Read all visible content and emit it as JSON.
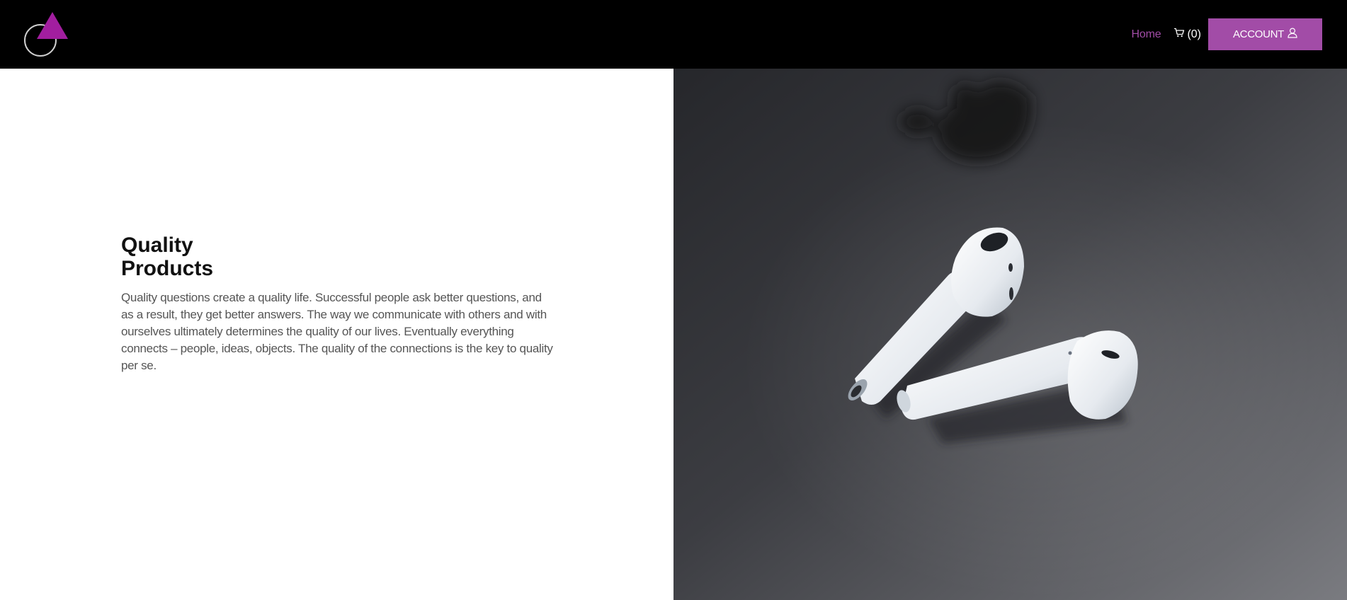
{
  "header": {
    "nav": {
      "home_label": "Home",
      "cart_count": "(0)",
      "account_label": "ACCOUNT"
    },
    "icons": [
      "logo-mark",
      "cart-icon",
      "user-icon"
    ]
  },
  "hero": {
    "title_line1": "Quality",
    "title_line2": "Products",
    "body": "Quality questions create a quality life. Successful people ask better questions, and as a result, they get better answers. The way we communicate with others and with ourselves ultimately determines the quality of our lives. Eventually everything connects – people, ideas, objects. The quality of the connections is the key to quality per se."
  },
  "image": {
    "subject": "white wireless earbuds on a dark surface"
  },
  "colors": {
    "accent": "#a24ca7",
    "header_bg": "#000000",
    "title": "#111111",
    "body_text": "#555555"
  }
}
